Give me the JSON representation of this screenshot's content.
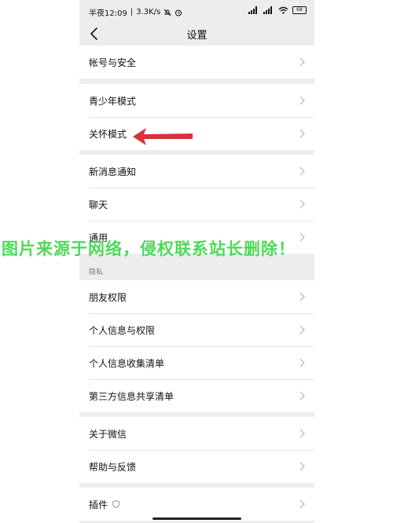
{
  "status_bar": {
    "time": "半夜12:09",
    "speed": "3.3K/s",
    "battery": "68"
  },
  "navbar": {
    "title": "设置"
  },
  "groups": [
    {
      "items": [
        {
          "label": "帐号与安全"
        }
      ]
    },
    {
      "items": [
        {
          "label": "青少年模式"
        },
        {
          "label": "关怀模式"
        }
      ]
    },
    {
      "items": [
        {
          "label": "新消息通知"
        },
        {
          "label": "聊天"
        },
        {
          "label": "通用"
        }
      ]
    },
    {
      "section_label": "隐私",
      "items": [
        {
          "label": "朋友权限"
        },
        {
          "label": "个人信息与权限"
        },
        {
          "label": "个人信息收集清单"
        },
        {
          "label": "第三方信息共享清单"
        }
      ]
    },
    {
      "items": [
        {
          "label": "关于微信"
        },
        {
          "label": "帮助与反馈"
        }
      ]
    },
    {
      "items": [
        {
          "label": "插件"
        }
      ]
    }
  ],
  "watermark": "图片来源于网络，侵权联系站长删除！",
  "colors": {
    "background": "#ededed",
    "watermark": "#43d94f",
    "arrow": "#d9303a"
  }
}
